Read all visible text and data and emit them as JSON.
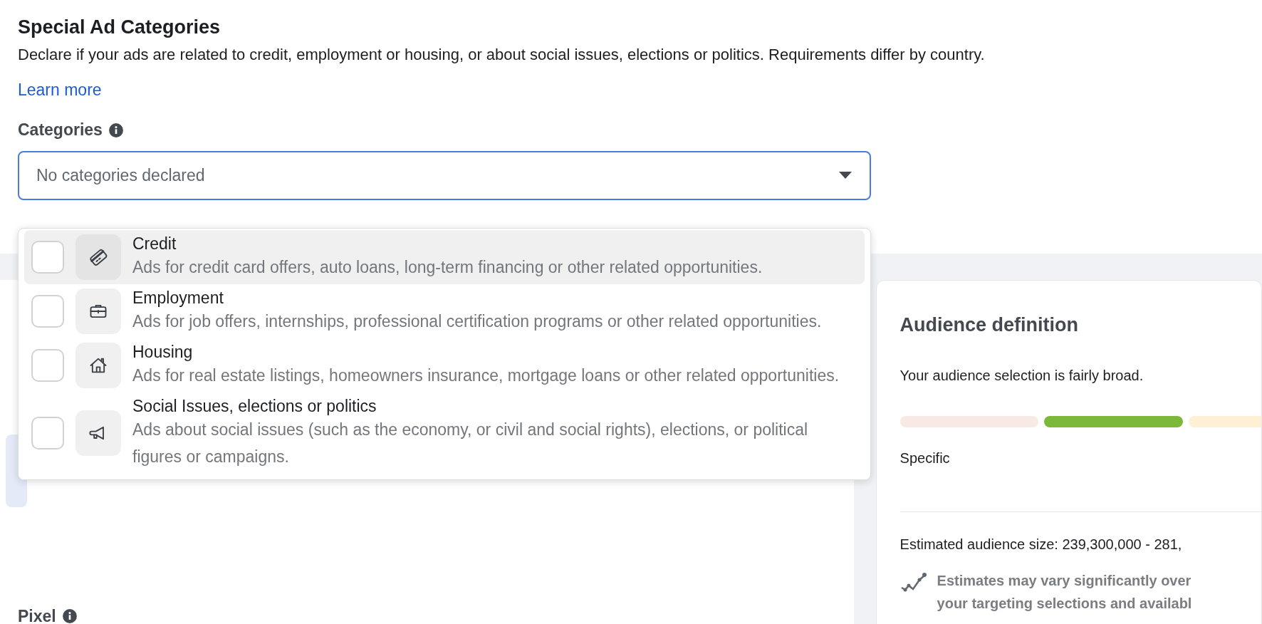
{
  "header": {
    "title": "Special Ad Categories",
    "description": "Declare if your ads are related to credit, employment or housing, or about social issues, elections or politics. Requirements differ by country.",
    "link": "Learn more"
  },
  "categories": {
    "label": "Categories",
    "select": {
      "placeholder": "No categories declared",
      "expanded": true
    },
    "options": [
      {
        "kind": "credit",
        "title": "Credit",
        "description": "Ads for credit card offers, auto loans, long-term financing or other related opportunities.",
        "checked": false,
        "selected": true
      },
      {
        "kind": "employment",
        "title": "Employment",
        "description": "Ads for job offers, internships, professional certification programs or other related opportunities.",
        "checked": false,
        "selected": false
      },
      {
        "kind": "housing",
        "title": "Housing",
        "description": "Ads for real estate listings, homeowners insurance, mortgage loans or other related opportunities.",
        "checked": false,
        "selected": false
      },
      {
        "kind": "social",
        "title": "Social Issues, elections or politics",
        "description": "Ads about social issues (such as the economy, or civil and social rights), elections, or political figures or campaigns.",
        "checked": false,
        "selected": false
      }
    ]
  },
  "left_panel": {
    "label": "Pixel"
  },
  "audience": {
    "title": "Audience definition",
    "summary": "Your audience selection is fairly broad.",
    "meter": [
      {
        "color": "#f8e9e4"
      },
      {
        "color": "#7cb83a"
      },
      {
        "color": "#fdf0d5"
      }
    ],
    "meter_label": "Specific",
    "estimate": "Estimated audience size: 239,300,000 - 281,",
    "note_lines": [
      "Estimates may vary significantly over",
      "your targeting selections and availabl"
    ]
  }
}
